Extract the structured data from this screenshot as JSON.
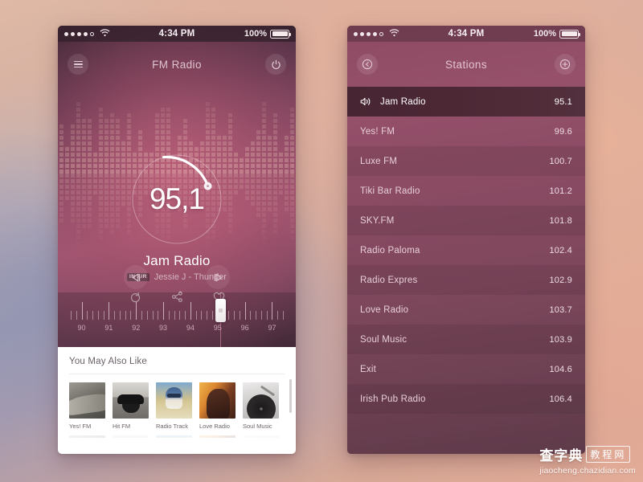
{
  "background": {
    "accent": "#8e4b63",
    "warm": "#e2b09c",
    "cool": "#9a9cb4"
  },
  "status_bar": {
    "signal_dots_filled": 4,
    "signal_dots_total": 5,
    "wifi_icon": "wifi-icon",
    "time": "4:34 PM",
    "battery_percent": "100%",
    "battery_icon": "battery-full-icon"
  },
  "player_screen": {
    "nav": {
      "menu_icon": "hamburger-menu-icon",
      "title": "FM Radio",
      "power_icon": "power-icon"
    },
    "dial": {
      "frequency": "95,1",
      "arc_progress_percent": 38,
      "handle_icon": "dial-handle-icon"
    },
    "now_playing": {
      "station": "Jam Radio",
      "badge": "IN AIR",
      "song": "Jessie J - Thunder"
    },
    "actions": [
      {
        "name": "replay-icon",
        "label": "Replay"
      },
      {
        "name": "share-icon",
        "label": "Share"
      },
      {
        "name": "heart-icon",
        "label": "Favorite"
      }
    ],
    "transport": {
      "prev_icon": "prev-track-icon",
      "next_icon": "next-track-icon"
    },
    "tuner": {
      "labels": [
        "90",
        "91",
        "92",
        "93",
        "94",
        "95",
        "96",
        "97"
      ],
      "range": [
        89.6,
        97.4
      ],
      "current": 95.1,
      "handle_icon": "tuner-handle-icon"
    },
    "also_like": {
      "title": "You May Also Like",
      "items": [
        {
          "name": "Yes! FM",
          "art": "t1"
        },
        {
          "name": "Hit FM",
          "art": "t2"
        },
        {
          "name": "Radio Track",
          "art": "t3"
        },
        {
          "name": "Love Radio",
          "art": "t4"
        },
        {
          "name": "Soul Music",
          "art": "t5"
        }
      ],
      "scrollbar_icon": "vertical-scrollbar"
    }
  },
  "stations_screen": {
    "nav": {
      "back_icon": "back-circle-icon",
      "title": "Stations",
      "add_icon": "plus-circle-icon"
    },
    "list": [
      {
        "name": "Jam Radio",
        "freq": "95.1",
        "active": true,
        "icon": "speaker-icon"
      },
      {
        "name": "Yes! FM",
        "freq": "99.6",
        "active": false
      },
      {
        "name": "Luxe FM",
        "freq": "100.7",
        "active": false
      },
      {
        "name": "Tiki Bar Radio",
        "freq": "101.2",
        "active": false
      },
      {
        "name": "SKY.FM",
        "freq": "101.8",
        "active": false
      },
      {
        "name": "Radio Paloma",
        "freq": "102.4",
        "active": false
      },
      {
        "name": "Radio Expres",
        "freq": "102.9",
        "active": false
      },
      {
        "name": "Love Radio",
        "freq": "103.7",
        "active": false
      },
      {
        "name": "Soul Music",
        "freq": "103.9",
        "active": false
      },
      {
        "name": "Exit",
        "freq": "104.6",
        "active": false
      },
      {
        "name": "Irish Pub Radio",
        "freq": "106.4",
        "active": false
      }
    ]
  },
  "watermark": {
    "brand": "查字典",
    "boxed": "教程网",
    "url": "jiaocheng.chazidian.com"
  }
}
